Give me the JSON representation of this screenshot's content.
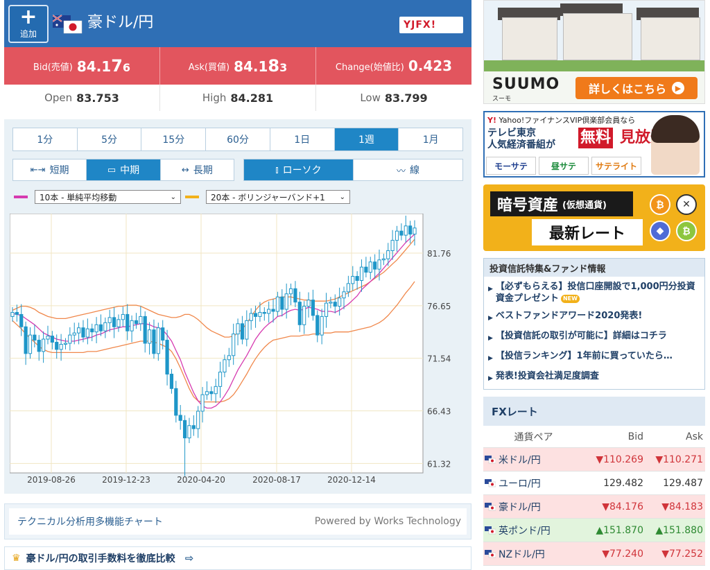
{
  "header": {
    "add_label": "追加",
    "pair_title": "豪ドル/円",
    "broker_logo": "YJFX!"
  },
  "quote": {
    "bid_label": "Bid(売値)",
    "bid_main": "84.1",
    "bid_big": "7",
    "bid_small": "6",
    "ask_label": "Ask(買値)",
    "ask_main": "84.1",
    "ask_big": "8",
    "ask_small": "3",
    "change_label": "Change(始値比)",
    "change_value": "0.423",
    "open_label": "Open",
    "open_value": "83.753",
    "high_label": "High",
    "high_value": "84.281",
    "low_label": "Low",
    "low_value": "83.799"
  },
  "timeframes": [
    "1分",
    "5分",
    "15分",
    "60分",
    "1日",
    "1週",
    "1月"
  ],
  "active_timeframe": "1週",
  "periods": [
    {
      "label": "短期",
      "icon": "arrows-in-icon"
    },
    {
      "label": "中期",
      "icon": "window-icon"
    },
    {
      "label": "長期",
      "icon": "arrows-out-icon"
    }
  ],
  "active_period": "中期",
  "chart_types": [
    {
      "label": "ローソク",
      "icon": "candlestick-icon"
    },
    {
      "label": "線",
      "icon": "line-chart-icon"
    }
  ],
  "active_chart_type": "ローソク",
  "indicators": {
    "ind1": {
      "label": "10本 - 単純平均移動",
      "color": "#d63ab0"
    },
    "ind2": {
      "label": "20本 - ボリンジャーバンド+1",
      "color": "#f2b11a"
    }
  },
  "chart_data": {
    "type": "candlestick",
    "title": "",
    "x_tick_labels": [
      "2019-08-26",
      "2019-12-23",
      "2020-04-20",
      "2020-08-17",
      "2020-12-14"
    ],
    "y_tick_labels": [
      "81.76",
      "76.65",
      "71.54",
      "66.43",
      "61.32"
    ],
    "y_ticks": [
      81.76,
      76.65,
      71.54,
      66.43,
      61.32
    ],
    "ylim": [
      60.4,
      85.6
    ],
    "close": [
      76.0,
      75.8,
      74.6,
      72.0,
      73.8,
      73.3,
      72.2,
      73.4,
      73.7,
      73.1,
      72.4,
      72.9,
      73.0,
      73.8,
      74.0,
      74.5,
      73.6,
      74.4,
      74.1,
      74.8,
      74.2,
      75.0,
      75.5,
      74.6,
      75.3,
      75.8,
      74.2,
      75.2,
      74.9,
      75.6,
      73.0,
      74.3,
      72.0,
      74.5,
      73.3,
      70.0,
      68.6,
      66.0,
      65.5,
      63.8,
      65.0,
      64.7,
      66.4,
      68.0,
      68.3,
      68.1,
      68.8,
      70.2,
      71.4,
      71.8,
      73.9,
      74.9,
      73.4,
      75.2,
      75.9,
      75.6,
      76.0,
      75.9,
      76.3,
      76.1,
      77.5,
      76.3,
      77.8,
      78.3,
      77.0,
      74.8,
      76.6,
      77.2,
      75.7,
      73.8,
      75.6,
      76.9,
      77.0,
      76.6,
      77.4,
      78.0,
      78.8,
      79.5,
      79.1,
      80.4,
      79.9,
      80.9,
      80.2,
      81.1,
      81.2,
      82.0,
      83.0,
      83.9,
      83.5,
      84.4,
      83.6,
      84.2
    ],
    "sma10": [
      75.9,
      75.8,
      75.7,
      75.4,
      75.1,
      74.8,
      74.4,
      74.0,
      73.8,
      73.6,
      73.4,
      73.3,
      73.2,
      73.2,
      73.2,
      73.3,
      73.4,
      73.5,
      73.6,
      73.8,
      73.9,
      74.1,
      74.3,
      74.4,
      74.5,
      74.6,
      74.6,
      74.7,
      74.8,
      74.9,
      74.9,
      74.8,
      74.6,
      74.5,
      74.3,
      73.8,
      73.2,
      72.3,
      71.4,
      70.2,
      69.2,
      68.2,
      67.4,
      66.9,
      66.7,
      66.7,
      66.9,
      67.3,
      67.9,
      68.6,
      69.5,
      70.4,
      71.1,
      71.8,
      72.6,
      73.4,
      74.0,
      74.5,
      74.9,
      75.2,
      75.6,
      75.7,
      76.0,
      76.2,
      76.3,
      76.2,
      76.3,
      76.5,
      76.4,
      76.3,
      76.1,
      76.1,
      76.1,
      76.0,
      76.2,
      76.5,
      76.8,
      77.2,
      77.6,
      78.2,
      78.6,
      79.0,
      79.4,
      79.8,
      80.3,
      80.8,
      81.3,
      81.8,
      82.3,
      82.8,
      83.2,
      83.6
    ],
    "bb_upper": [
      76.2,
      76.4,
      76.6,
      76.6,
      76.5,
      76.3,
      76.0,
      75.8,
      75.6,
      75.5,
      75.4,
      75.4,
      75.4,
      75.5,
      75.6,
      75.7,
      75.8,
      75.9,
      76.0,
      76.1,
      76.2,
      76.3,
      76.4,
      76.5,
      76.6,
      76.6,
      76.7,
      76.7,
      76.7,
      76.6,
      76.4,
      76.2,
      76.0,
      75.8,
      75.7,
      75.6,
      75.5,
      75.5,
      75.6,
      75.8,
      75.8,
      75.6,
      75.3,
      74.9,
      74.5,
      74.2,
      74.0,
      73.8,
      73.6,
      73.6,
      73.7,
      74.0,
      74.4,
      74.9,
      75.6,
      76.2,
      76.7,
      77.0,
      77.2,
      77.3,
      77.4,
      77.5,
      77.5,
      77.5,
      77.4,
      77.3,
      77.2,
      77.2,
      77.1,
      77.1,
      77.1,
      77.1,
      77.2,
      77.3,
      77.5,
      77.7,
      77.9,
      78.1,
      78.3,
      78.5,
      78.7,
      79.0,
      79.3,
      79.6,
      79.9,
      80.3,
      80.7,
      81.1,
      81.6,
      82.1,
      82.6,
      83.1
    ],
    "bb_lower": [
      75.2,
      74.8,
      74.4,
      73.9,
      73.5,
      73.1,
      72.7,
      72.4,
      72.2,
      72.1,
      72.1,
      72.1,
      72.1,
      72.1,
      72.1,
      72.1,
      72.1,
      72.2,
      72.2,
      72.2,
      72.3,
      72.4,
      72.5,
      72.6,
      72.7,
      72.8,
      72.9,
      73.0,
      73.1,
      73.2,
      73.2,
      73.2,
      73.1,
      73.0,
      72.8,
      72.6,
      72.2,
      71.5,
      70.6,
      69.6,
      68.6,
      67.8,
      67.4,
      67.3,
      67.3,
      67.3,
      67.3,
      67.3,
      67.4,
      67.6,
      68.0,
      68.6,
      69.3,
      70.0,
      70.8,
      71.5,
      72.1,
      72.6,
      73.0,
      73.3,
      73.4,
      73.5,
      73.6,
      73.7,
      73.7,
      73.7,
      73.8,
      73.8,
      73.9,
      73.9,
      74.0,
      74.0,
      74.0,
      74.1,
      74.1,
      74.1,
      74.1,
      74.2,
      74.3,
      74.4,
      74.5,
      74.6,
      74.8,
      75.0,
      75.3,
      75.7,
      76.2,
      76.7,
      77.3,
      77.9,
      78.4,
      79.0
    ]
  },
  "tech_link": "テクニカル分析用多機能チャート",
  "powered_by": "Powered by Works Technology",
  "compare_link": "豪ドル/円の取引手数料を徹底比較",
  "ads": {
    "suumo_brand": "SUUMO",
    "suumo_sub": "スーモ",
    "suumo_cta": "詳しくはこちら",
    "yahoo_top_prefix": "Yahoo!ファイナンス",
    "yahoo_top": "Yahoo!ファイナンスVIP倶楽部会員なら",
    "yahoo_tv1": "テレビ東京",
    "yahoo_tv2": "人気経済番組が",
    "yahoo_free": "無料",
    "yahoo_mi": "見放題!",
    "yahoo_progs": [
      "モーサテ",
      "昼サテ",
      "サテライト"
    ],
    "crypto_line1": "暗号資産",
    "crypto_sub": "(仮想通貨)",
    "crypto_line2": "最新レート"
  },
  "fund": {
    "title": "投資信託特集&ファンド情報",
    "items": [
      "【必ずもらえる】投信口座開設で1,000円分投資資金プレゼント",
      "ベストファンドアワード2020発表!",
      "【投資信託の取引が可能に】詳細はコチラ",
      "【投信ランキング】1年前に買っていたら…",
      "発表!投資会社満足度調査"
    ],
    "new_badge": "NEW"
  },
  "fx": {
    "title": "FXレート",
    "col_pair": "通貨ペア",
    "col_bid": "Bid",
    "col_ask": "Ask",
    "rows": [
      {
        "pair": "米ドル/円",
        "bid": "▼110.269",
        "ask": "▼110.271",
        "trend": "down"
      },
      {
        "pair": "ユーロ/円",
        "bid": "129.482",
        "ask": "129.487",
        "trend": "flat"
      },
      {
        "pair": "豪ドル/円",
        "bid": "▼84.176",
        "ask": "▼84.183",
        "trend": "down"
      },
      {
        "pair": "英ポンド/円",
        "bid": "▲151.870",
        "ask": "▲151.880",
        "trend": "up"
      },
      {
        "pair": "NZドル/円",
        "bid": "▼77.240",
        "ask": "▼77.252",
        "trend": "down"
      }
    ]
  }
}
